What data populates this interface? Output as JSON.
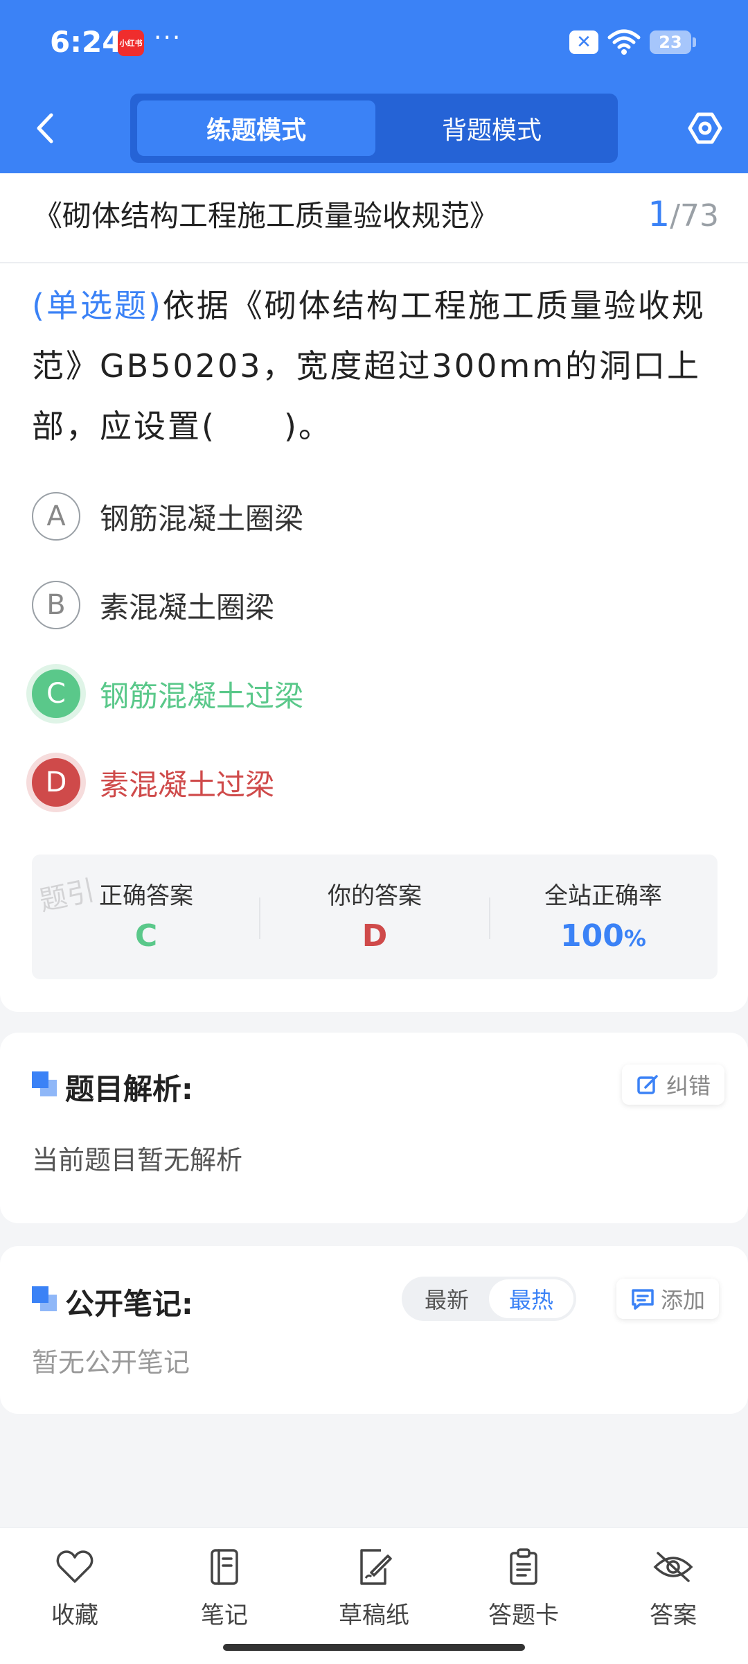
{
  "status_bar": {
    "time": "6:24",
    "app_badge": "小红书",
    "more": "···",
    "battery": "23",
    "sim_icon": "sim-off-icon",
    "wifi_icon": "wifi-icon"
  },
  "header": {
    "back_icon": "back-chevron-icon",
    "tabs": [
      {
        "label": "练题模式",
        "active": true
      },
      {
        "label": "背题模式",
        "active": false
      }
    ],
    "settings_icon": "settings-hex-icon",
    "brand_color": "#3b82f6"
  },
  "question": {
    "doc_title": "《砌体结构工程施工质量验收规范》",
    "current": "1",
    "total": "/73",
    "type_label": "(单选题)",
    "stem": "依据《砌体结构工程施工质量验收规范》GB50203，宽度超过300mm的洞口上部，应设置(　　)。",
    "options": [
      {
        "letter": "A",
        "text": "钢筋混凝土圈梁",
        "state": "normal"
      },
      {
        "letter": "B",
        "text": "素混凝土圈梁",
        "state": "normal"
      },
      {
        "letter": "C",
        "text": "钢筋混凝土过梁",
        "state": "correct"
      },
      {
        "letter": "D",
        "text": "素混凝土过梁",
        "state": "wrong"
      }
    ]
  },
  "result": {
    "watermark": "题引",
    "correct_label": "正确答案",
    "correct_value": "C",
    "yours_label": "你的答案",
    "yours_value": "D",
    "rate_label": "全站正确率",
    "rate_value": "100",
    "rate_unit": "%",
    "correct_color": "#5ac88a",
    "wrong_color": "#cf4a4a"
  },
  "analysis": {
    "title": "题目解析:",
    "report_label": "纠错",
    "report_icon": "edit-icon",
    "content": "当前题目暂无解析"
  },
  "notes": {
    "title": "公开笔记:",
    "sort_newest": "最新",
    "sort_hottest": "最热",
    "add_label": "添加",
    "add_icon": "comment-icon",
    "content": "暂无公开笔记"
  },
  "bottom_nav": [
    {
      "label": "收藏",
      "icon": "heart-icon"
    },
    {
      "label": "笔记",
      "icon": "notebook-icon"
    },
    {
      "label": "草稿纸",
      "icon": "draft-icon"
    },
    {
      "label": "答题卡",
      "icon": "clipboard-icon"
    },
    {
      "label": "答案",
      "icon": "eye-off-icon"
    }
  ]
}
